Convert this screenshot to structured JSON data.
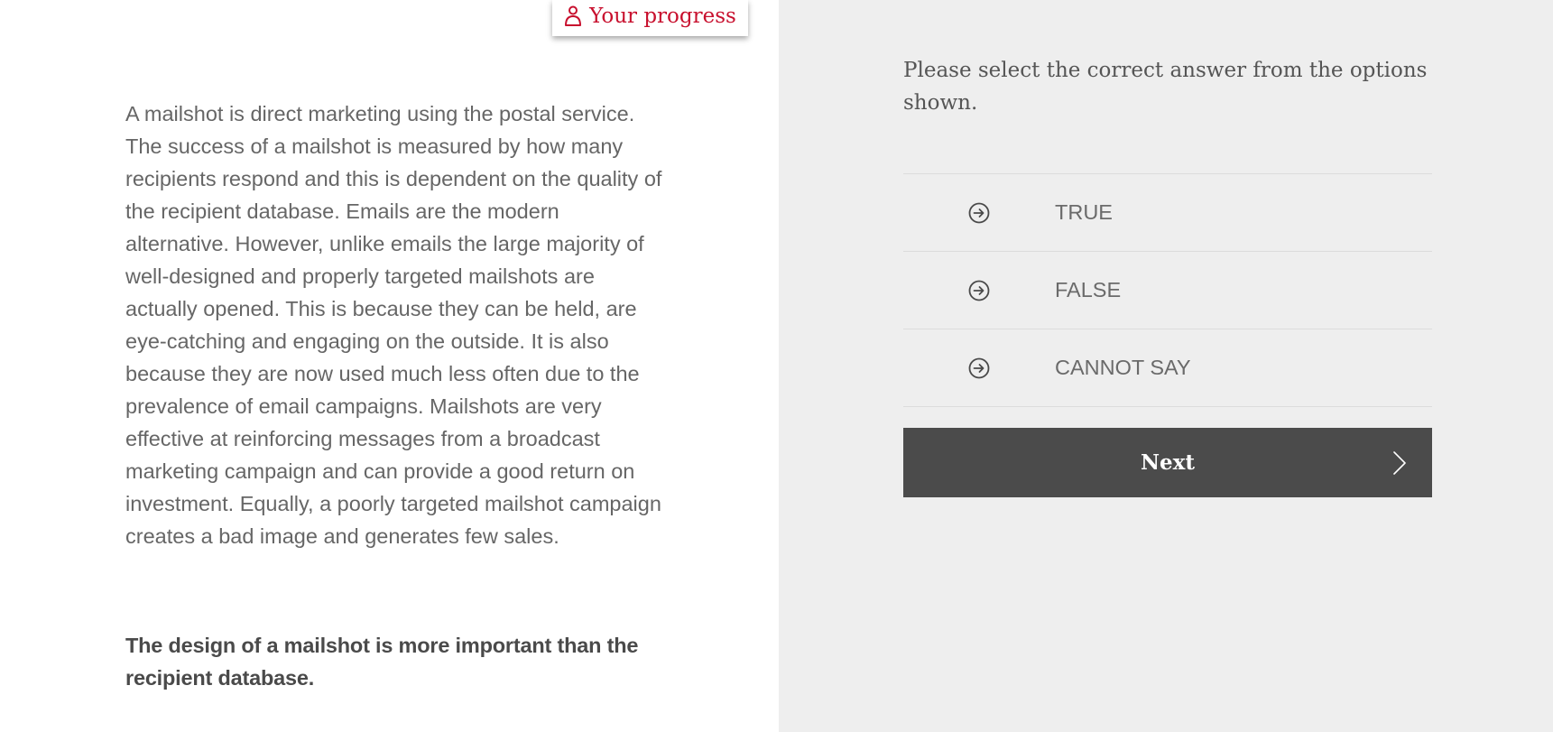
{
  "header": {
    "progress_label": "Your progress",
    "progress_icon": "user-icon"
  },
  "passage": {
    "text": "A mailshot is direct marketing using the postal service. The success of a mailshot is measured by how many recipients respond and this is dependent on the quality of the recipient database. Emails are the modern alternative. However, unlike emails the large majority of well-designed and properly targeted mailshots are actually opened. This is because they can be held, are eye-catching and engaging on the outside. It is also because they are now used much less often due to the prevalence of email campaigns. Mailshots are very effective at reinforcing messages from a broadcast marketing campaign and can provide a good return on investment. Equally, a poorly targeted mailshot campaign creates a bad image and generates few sales.",
    "statement": "The design of a mailshot is more important than the recipient database."
  },
  "question": {
    "instruction": "Please select the correct answer from the options shown.",
    "options": [
      {
        "label": "TRUE",
        "icon": "arrow-circle-right-icon"
      },
      {
        "label": "FALSE",
        "icon": "arrow-circle-right-icon"
      },
      {
        "label": "CANNOT SAY",
        "icon": "arrow-circle-right-icon"
      }
    ],
    "next_label": "Next",
    "next_icon": "chevron-right-icon"
  },
  "colors": {
    "accent": "#c8102e",
    "panel_background": "#eeeeee",
    "button_background": "#4b4b4b",
    "text": "#666666"
  }
}
